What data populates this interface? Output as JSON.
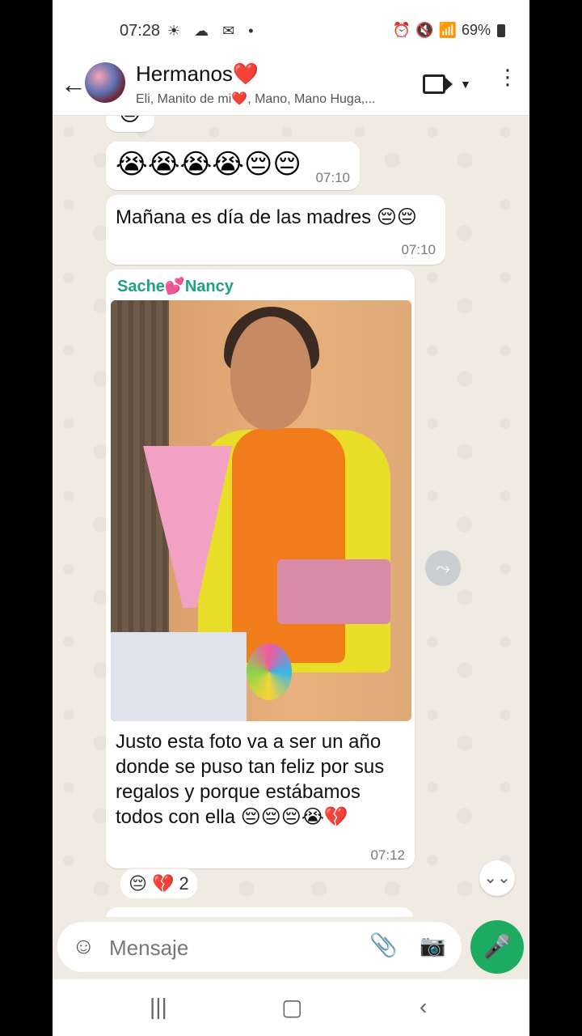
{
  "status": {
    "time": "07:28",
    "left_icons": "☀ ☁ ✉ •",
    "battery": "69%"
  },
  "header": {
    "title": "Hermanos❤️",
    "members": "Eli, Manito de mi❤️, Mano, Mano Huga,..."
  },
  "messages": {
    "peek_emoji": "😔",
    "m1": {
      "emojis": "😭😭😭😭😔😔",
      "time": "07:10"
    },
    "m2": {
      "text": "Mañana es día de las madres 😔😔",
      "time": "07:10"
    },
    "m3": {
      "sender": "Sache💕Nancy",
      "text": "Justo esta foto va a ser un año donde se puso tan feliz por sus regalos y porque estábamos todos con ella 😔😔😔😭💔",
      "time": "07:12",
      "reactions": "😔 💔",
      "reaction_count": "2"
    }
  },
  "input": {
    "placeholder": "Mensaje"
  },
  "icons": {
    "back": "←",
    "menu": "⋮",
    "forward": "⤳",
    "scroll_down": "⌄⌄",
    "sticker": "☺",
    "attach": "📎",
    "camera": "📷",
    "mic": "🎤",
    "nav_recent": "|||",
    "nav_home": "▢",
    "nav_back": "‹"
  },
  "colors": {
    "sender_name": "#1fa185",
    "mic_button": "#1daa61",
    "chat_background": "#efeae2"
  }
}
